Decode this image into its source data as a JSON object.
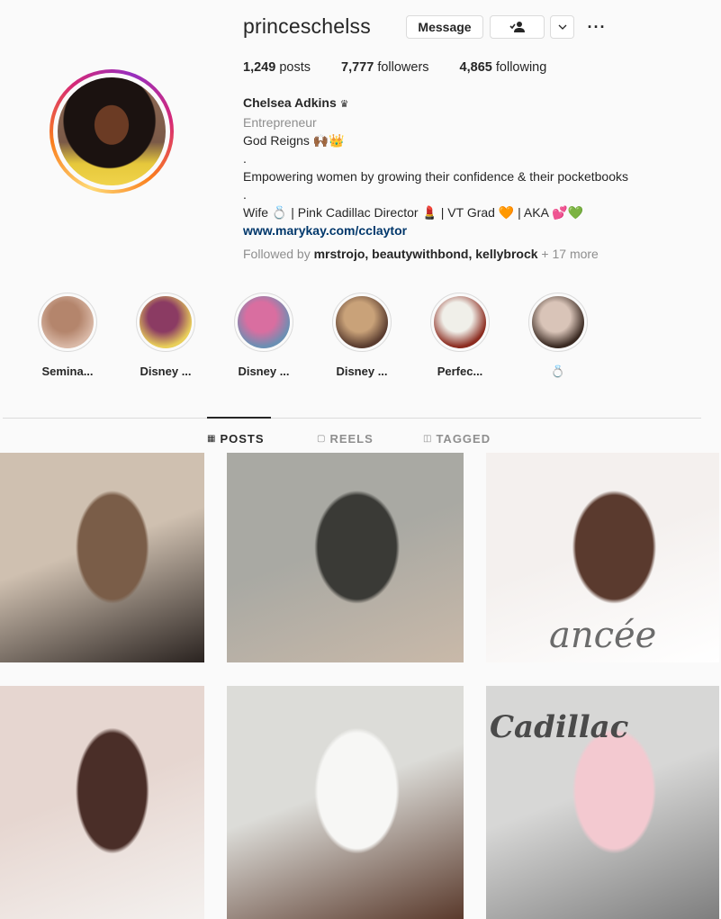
{
  "profile": {
    "username": "princeschelss",
    "message_label": "Message",
    "follow_icon": "person-check-icon",
    "chevron": "⌄",
    "more": "···"
  },
  "stats": {
    "posts_count": "1,249",
    "posts_label": "posts",
    "followers_count": "7,777",
    "followers_label": "followers",
    "following_count": "4,865",
    "following_label": "following"
  },
  "bio": {
    "name": "Chelsea Adkins",
    "name_emoji": "♛",
    "category": "Entrepreneur",
    "line1": "God Reigns 🙌🏾👑",
    "dot1": ".",
    "line2": "Empowering women by growing their confidence & their pocketbooks",
    "dot2": ".",
    "line3": "Wife 💍 | Pink Cadillac Director 💄 | VT Grad 🧡 | AKA 💕💚",
    "link": "www.marykay.com/cclaytor",
    "followed_by_prefix": "Followed by",
    "followed_users": "mrstrojo, beautywithbond, kellybrock",
    "followed_more": "+ 17 more"
  },
  "highlights": [
    {
      "label": "Semina...",
      "colors": [
        "#d9b8a6",
        "#b4856c"
      ]
    },
    {
      "label": "Disney ...",
      "colors": [
        "#e9cf5a",
        "#8b3b63"
      ]
    },
    {
      "label": "Disney ...",
      "colors": [
        "#6b8fb3",
        "#d96ea0"
      ]
    },
    {
      "label": "Disney ...",
      "colors": [
        "#5a3c2f",
        "#c9a279"
      ]
    },
    {
      "label": "Perfec...",
      "colors": [
        "#8b2b1f",
        "#f0efe9"
      ]
    },
    {
      "label": "💍",
      "colors": [
        "#3a2a22",
        "#d9c4b8"
      ]
    }
  ],
  "tabs": {
    "posts": "POSTS",
    "posts_icon": "▦",
    "reels": "REELS",
    "reels_icon": "▢",
    "tagged": "TAGGED",
    "tagged_icon": "◫"
  },
  "posts": [
    {
      "name": "post-atv-boots",
      "colors": [
        "#cfc0b0",
        "#7a5d48",
        "#2a2320"
      ]
    },
    {
      "name": "post-couple-atv",
      "colors": [
        "#a9a9a3",
        "#3a3a36",
        "#c9b9a9"
      ]
    },
    {
      "name": "post-fiancee-mug",
      "colors": [
        "#f4f0ee",
        "#5a3a2e",
        "#ffffff"
      ]
    },
    {
      "name": "post-sunglasses",
      "colors": [
        "#e6d6d0",
        "#4a2e28",
        "#f4f1ef"
      ]
    },
    {
      "name": "post-balloons",
      "colors": [
        "#dcdcd8",
        "#f7f7f5",
        "#5a3a2c"
      ]
    },
    {
      "name": "post-pink-cadillac",
      "colors": [
        "#d7d7d6",
        "#f3c9d0",
        "#7e7e7e"
      ]
    }
  ],
  "post_texts": {
    "fiancee": "ancée",
    "cadillac": "Cadillac"
  }
}
